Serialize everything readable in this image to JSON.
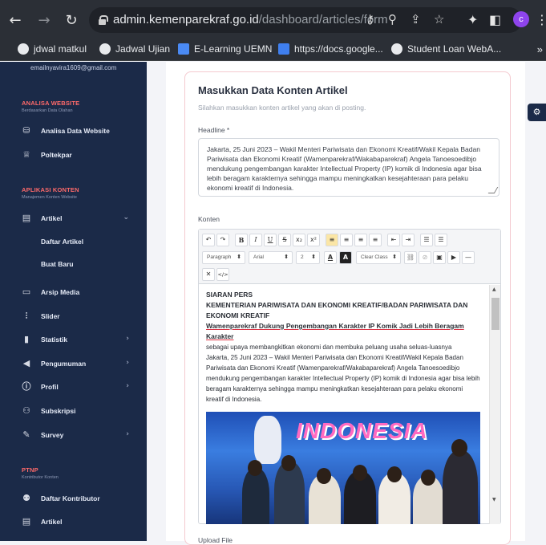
{
  "browser": {
    "url_domain": "admin.kemenparekraf.go.id",
    "url_path": "/dashboard/articles/form",
    "profile_initial": "c",
    "bookmarks": [
      "jdwal matkul",
      "Jadwal Ujian",
      "E-Learning UEMN",
      "https://docs.google...",
      "Student Loan WebA..."
    ],
    "bookmarks_more": "»"
  },
  "sidebar": {
    "email": "emailnyavira1609@gmail.com",
    "sections": [
      {
        "title": "ANALISA WEBSITE",
        "subtitle": "Berdasarkan Data Olahan"
      },
      {
        "title": "APLIKASI KONTEN",
        "subtitle": "Manajemen Konten Website"
      },
      {
        "title": "PTNP",
        "subtitle": "Kontributor Konten"
      }
    ],
    "items": [
      {
        "label": "Analisa Data Website",
        "icon": "database-icon"
      },
      {
        "label": "Poltekpar",
        "icon": "graduation-cap-icon"
      },
      {
        "label": "Artikel",
        "icon": "article-icon"
      },
      {
        "label": "Daftar Artikel"
      },
      {
        "label": "Buat Baru"
      },
      {
        "label": "Arsip Media",
        "icon": "archive-icon"
      },
      {
        "label": "Slider",
        "icon": "slider-icon"
      },
      {
        "label": "Statistik",
        "icon": "bar-chart-icon"
      },
      {
        "label": "Pengumuman",
        "icon": "megaphone-icon"
      },
      {
        "label": "Profil",
        "icon": "info-icon"
      },
      {
        "label": "Subskripsi",
        "icon": "users-icon"
      },
      {
        "label": "Survey",
        "icon": "edit-icon"
      },
      {
        "label": "Daftar Kontributor",
        "icon": "contributors-icon"
      },
      {
        "label": "Artikel",
        "icon": "article-icon"
      }
    ]
  },
  "form": {
    "title": "Masukkan Data Konten Artikel",
    "subtitle": "Silahkan masukkan konten artikel yang akan di posting.",
    "headline_label": "Headline *",
    "headline_value": "Jakarta, 25 Juni 2023 – Wakil Menteri Pariwisata dan Ekonomi Kreatif/Wakil Kepala Badan Pariwisata dan Ekonomi Kreatif (Wamenparekraf/Wakabaparekraf) Angela Tanoesoedibjo mendukung pengembangan karakter Intellectual Property (IP) komik di Indonesia agar bisa lebih beragam karakternya sehingga mampu meningkatkan kesejahteraan para pelaku ekonomi kreatif di Indonesia.",
    "konten_label": "Konten",
    "upload_label": "Upload File"
  },
  "toolbar": {
    "row1": [
      "↶",
      "↷",
      "B",
      "I",
      "U",
      "S",
      "x₂",
      "x²",
      "≡",
      "≡",
      "≡",
      "≡",
      "⇤",
      "⇥",
      "☰",
      "☰"
    ],
    "paragraph_select": "Paragraph",
    "font_select": "Arial",
    "size_select": "2",
    "font_color": "A",
    "bg_color": "A",
    "clear_class": "Clear Class",
    "remove_btn": "✕",
    "code_btn": "</>"
  },
  "editor": {
    "line1": "SIARAN PERS",
    "line2": "KEMENTERIAN PARIWISATA DAN EKONOMI KREATIF/BADAN PARIWISATA DAN EKONOMI KREATIF",
    "line3": "Wamenparekraf Dukung Pengembangan Karakter IP Komik Jadi Lebih Beragam Karakter",
    "line4": "sebagai upaya membangkitkan ekonomi dan membuka peluang usaha seluas-luasnya",
    "para": "Jakarta, 25 Juni 2023 – Wakil Menteri Pariwisata dan Ekonomi Kreatif/Wakil Kepala Badan Pariwisata dan Ekonomi Kreatif (Wamenparekraf/Wakabaparekraf) Angela Tanoesoedibjo mendukung pengembangan karakter Intellectual Property (IP) komik di Indonesia agar bisa lebih beragam karakternya sehingga mampu meningkatkan kesejahteraan para pelaku ekonomi kreatif di Indonesia.",
    "photo_text": "INDONESIA"
  },
  "colors": {
    "sidebar_bg": "#1b2a48",
    "section_accent": "#ff6a6a",
    "active_toolbar": "#fbe6a6"
  }
}
